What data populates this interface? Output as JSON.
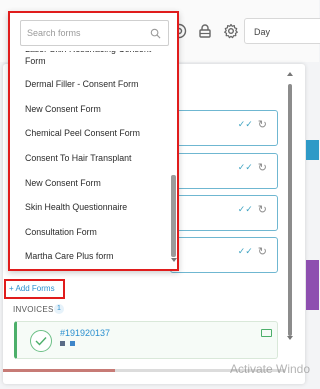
{
  "toolbar": {
    "day_select_value": "Day",
    "icons": [
      "help-icon",
      "lock-icon",
      "gear-icon"
    ]
  },
  "form_search": {
    "placeholder": "Search forms",
    "items": [
      "Laser Skin Resurfacing Consent Form",
      "Dermal Filler - Consent Form",
      "New Consent Form",
      "Chemical Peel Consent Form",
      "Consent To Hair Transplant",
      "New Consent Form",
      "Skin Health Questionnaire",
      "Consultation Form",
      "Martha Care Plus form"
    ]
  },
  "forms_section": {
    "add_forms_label": "+ Add Forms"
  },
  "invoices": {
    "heading": "INVOICES",
    "count": "1",
    "items": [
      {
        "number": "#191920137"
      }
    ]
  },
  "watermark": "Activate Windo",
  "colors": {
    "accent_blue": "#2a8fcf",
    "highlight_red": "#e01c1c",
    "invoice_green": "#4caf6a"
  }
}
